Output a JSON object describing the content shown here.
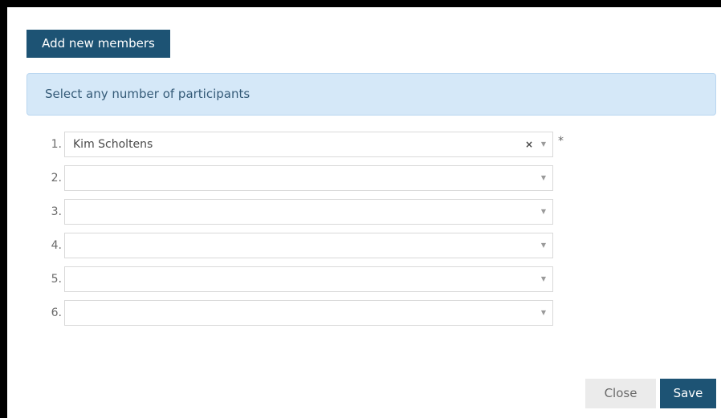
{
  "header": {
    "add_button_label": "Add new members"
  },
  "info": {
    "text": "Select any number of participants"
  },
  "participants": [
    {
      "number": "1.",
      "value": "Kim Scholtens",
      "clear": "×",
      "caret": "▼",
      "required_mark": "*"
    },
    {
      "number": "2.",
      "value": "",
      "caret": "▼"
    },
    {
      "number": "3.",
      "value": "",
      "caret": "▼"
    },
    {
      "number": "4.",
      "value": "",
      "caret": "▼"
    },
    {
      "number": "5.",
      "value": "",
      "caret": "▼"
    },
    {
      "number": "6.",
      "value": "",
      "caret": "▼"
    }
  ],
  "footer": {
    "close_label": "Close",
    "save_label": "Save"
  },
  "colors": {
    "primary": "#1d5374",
    "info_bg": "#d5e8f8",
    "close_bg": "#ebebeb"
  }
}
